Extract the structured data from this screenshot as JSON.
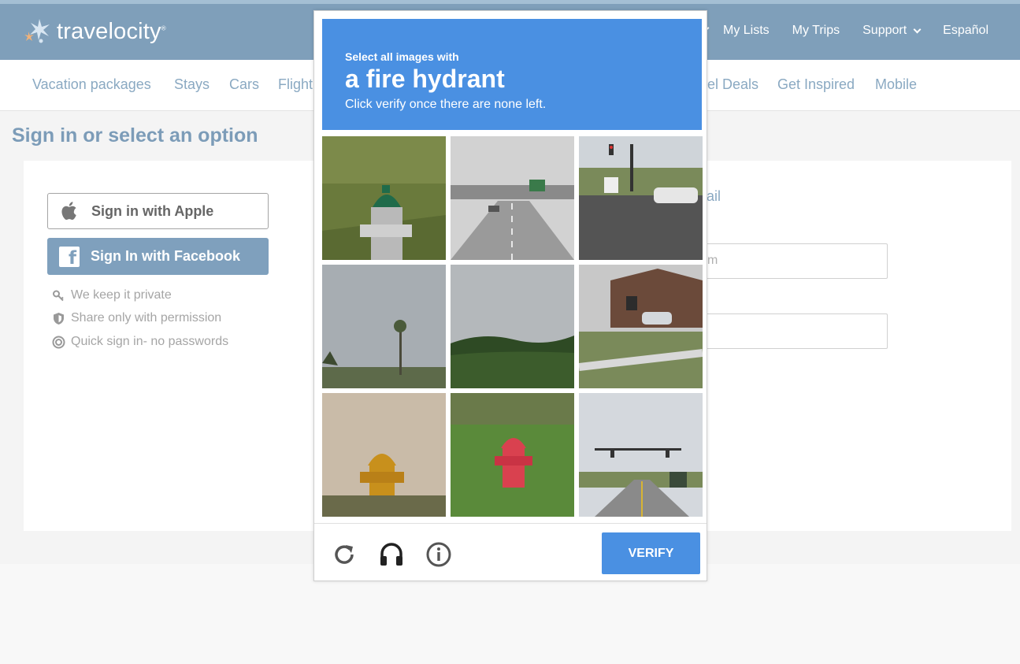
{
  "header": {
    "logo_text": "travelocity",
    "logo_mark": "®",
    "nav": [
      "My Lists",
      "My Trips",
      "Support",
      "Español"
    ]
  },
  "subnav": [
    "Vacation packages",
    "Stays",
    "Cars",
    "Flight",
    "el Deals",
    "Get Inspired",
    "Mobile"
  ],
  "page": {
    "title": "Sign in or select an option",
    "apple_label": "Sign in with Apple",
    "facebook_label": "Sign In with Facebook",
    "facebook_icon": "f",
    "perks": [
      "We keep it private",
      "Share only with permission",
      "Quick sign in- no passwords"
    ],
    "email_fragment": "ail",
    "field1_fragment": "m"
  },
  "captcha": {
    "prompt_small": "Select all images with",
    "prompt_object": "a fire hydrant",
    "prompt_instruction": "Click verify once there are none left.",
    "verify_label": "VERIFY",
    "tiles": [
      "green-hydrant",
      "highway-overpass",
      "intersection",
      "palm-sky",
      "green-hills",
      "brick-house-street",
      "yellow-hydrant",
      "red-hydrant",
      "road-traffic-light"
    ],
    "icons": [
      "reload-icon",
      "audio-icon",
      "info-icon"
    ]
  },
  "colors": {
    "header_bg": "#7f9fba",
    "captcha_blue": "#4a90e2",
    "link_blue": "#8aa9c2"
  }
}
